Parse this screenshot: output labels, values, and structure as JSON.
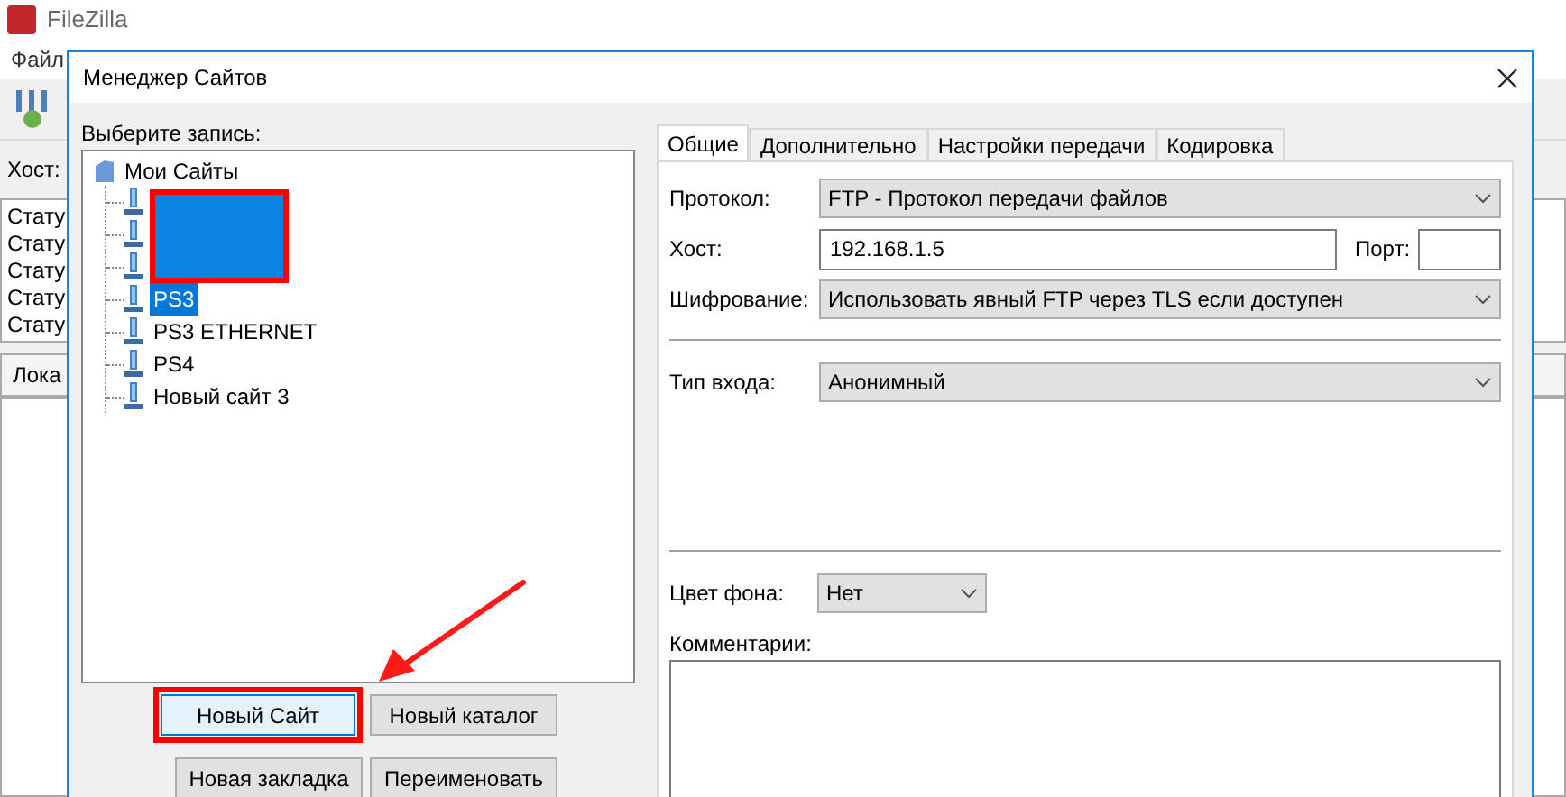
{
  "app_window": {
    "title": "FileZilla",
    "menu": [
      "Файл"
    ],
    "host_label": "Хост:",
    "status_log": [
      "Стату",
      "Стату",
      "Стату",
      "Стату",
      "Стату"
    ],
    "local_panel_header": "Лока"
  },
  "dialog": {
    "title": "Менеджер Сайтов",
    "select_label": "Выберите запись:",
    "tree": {
      "label": "Мои Сайты",
      "children": [
        {
          "kind": "hidden"
        },
        {
          "kind": "hidden"
        },
        {
          "kind": "hidden"
        },
        {
          "kind": "site",
          "label": "PS3",
          "selected": true
        },
        {
          "kind": "site",
          "label": "PS3 ETHERNET",
          "selected": false
        },
        {
          "kind": "site",
          "label": "PS4",
          "selected": false
        },
        {
          "kind": "site",
          "label": "Новый сайт 3",
          "selected": false
        }
      ]
    },
    "buttons": [
      {
        "label": "Новый Сайт",
        "highlighted": true
      },
      {
        "label": "Новый каталог",
        "highlighted": false
      },
      {
        "label": "Новая закладка",
        "highlighted": false
      },
      {
        "label": "Переименовать",
        "highlighted": false
      }
    ],
    "tabs": [
      {
        "label": "Общие",
        "selected": true
      },
      {
        "label": "Дополнительно",
        "selected": false
      },
      {
        "label": "Настройки передачи",
        "selected": false
      },
      {
        "label": "Кодировка",
        "selected": false
      }
    ],
    "protocol": {
      "label": "Протокол:",
      "value": "FTP - Протокол передачи файлов"
    },
    "host": {
      "label": "Хост:",
      "value": "192.168.1.5"
    },
    "port": {
      "label": "Порт:"
    },
    "encryption": {
      "label": "Шифрование:",
      "value": "Использовать явный FTP через TLS если доступен"
    },
    "logon_type": {
      "label": "Тип входа:",
      "value": "Анонимный"
    },
    "background_color": {
      "label": "Цвет фона:",
      "value": "Нет"
    },
    "comments": {
      "label": "Комментарии:"
    }
  }
}
